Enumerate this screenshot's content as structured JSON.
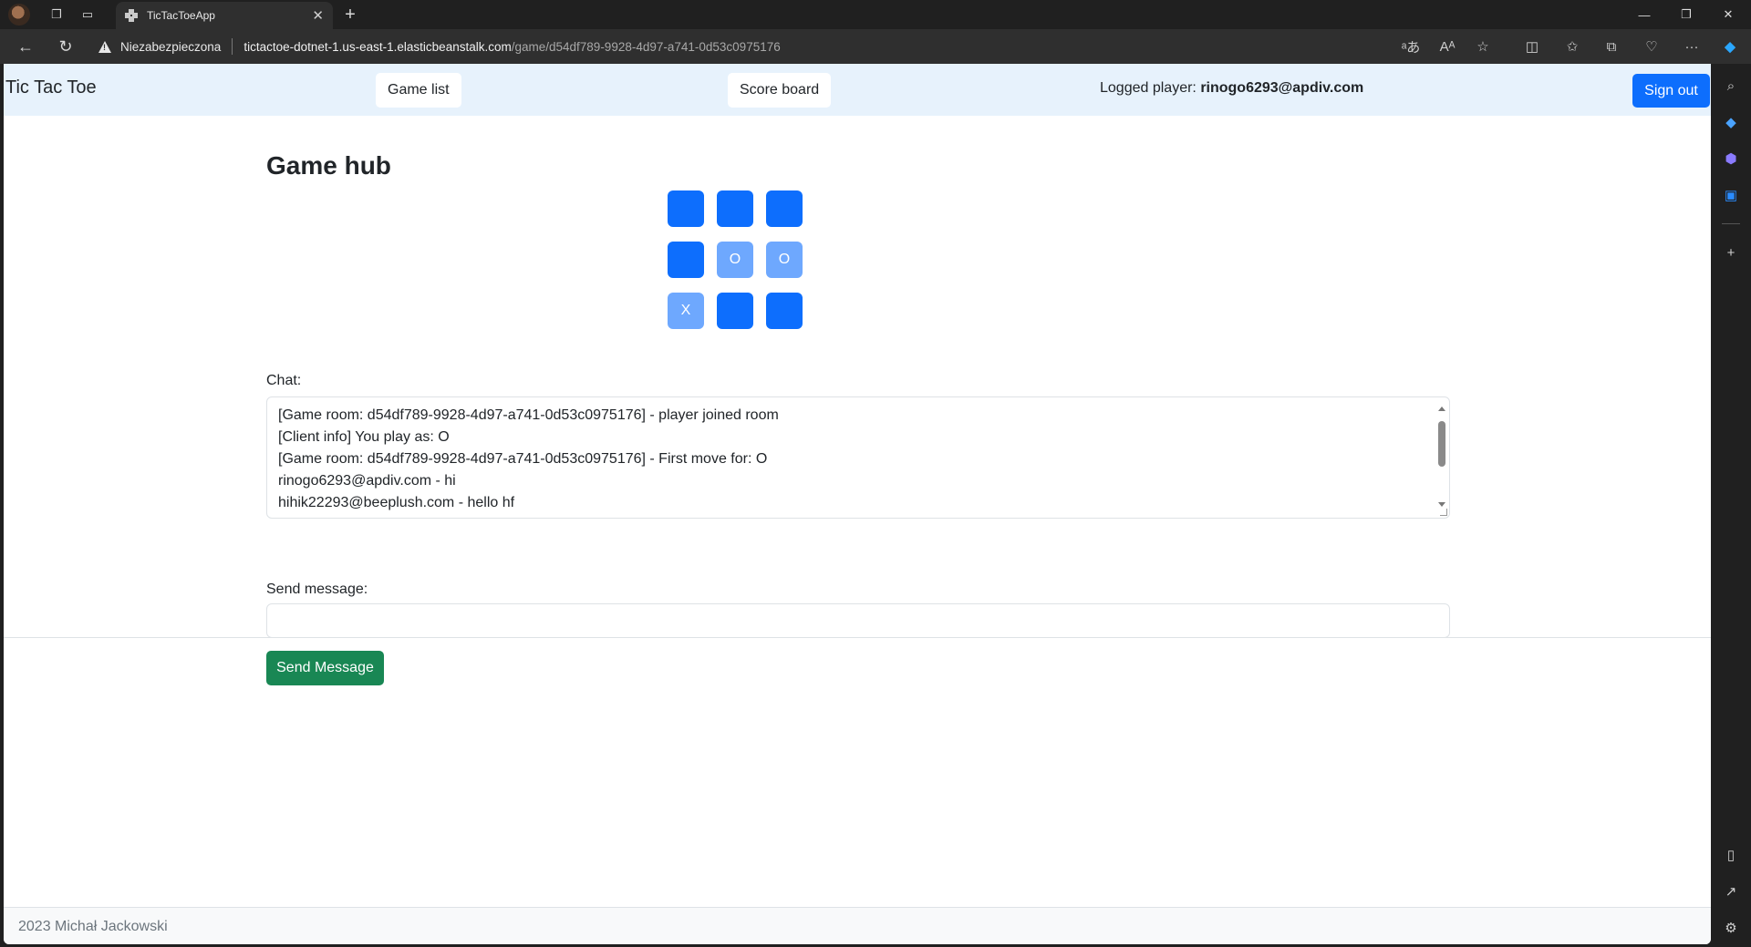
{
  "browser": {
    "tab_title": "TicTacToeApp",
    "security_label": "Niezabezpieczona",
    "url_host": "tictactoe-dotnet-1.us-east-1.elasticbeanstalk.com",
    "url_path": "/game/d54df789-9928-4d97-a741-0d53c0975176"
  },
  "navbar": {
    "brand": "Tic Tac Toe",
    "game_list": "Game list",
    "score_board": "Score board",
    "logged_label": "Logged player: ",
    "logged_user": "rinogo6293@apdiv.com",
    "sign_out": "Sign out"
  },
  "main": {
    "heading": "Game hub",
    "board": [
      "",
      "",
      "",
      "",
      "O",
      "O",
      "X",
      "",
      ""
    ],
    "chat_label": "Chat:",
    "chat_lines": [
      "[Game room: d54df789-9928-4d97-a741-0d53c0975176] - player joined room",
      "[Client info] You play as: O",
      "[Game room: d54df789-9928-4d97-a741-0d53c0975176] - First move for: O",
      "rinogo6293@apdiv.com - hi",
      "hihik22293@beeplush.com - hello hf"
    ],
    "send_label": "Send message:",
    "message_value": "",
    "send_button": "Send Message"
  },
  "footer": {
    "text": "2023 Michał Jackowski"
  },
  "colors": {
    "primary": "#0d6efd",
    "cell_filled": "#6ea8fe",
    "success": "#198754",
    "navbar_bg": "#e7f2fc"
  }
}
